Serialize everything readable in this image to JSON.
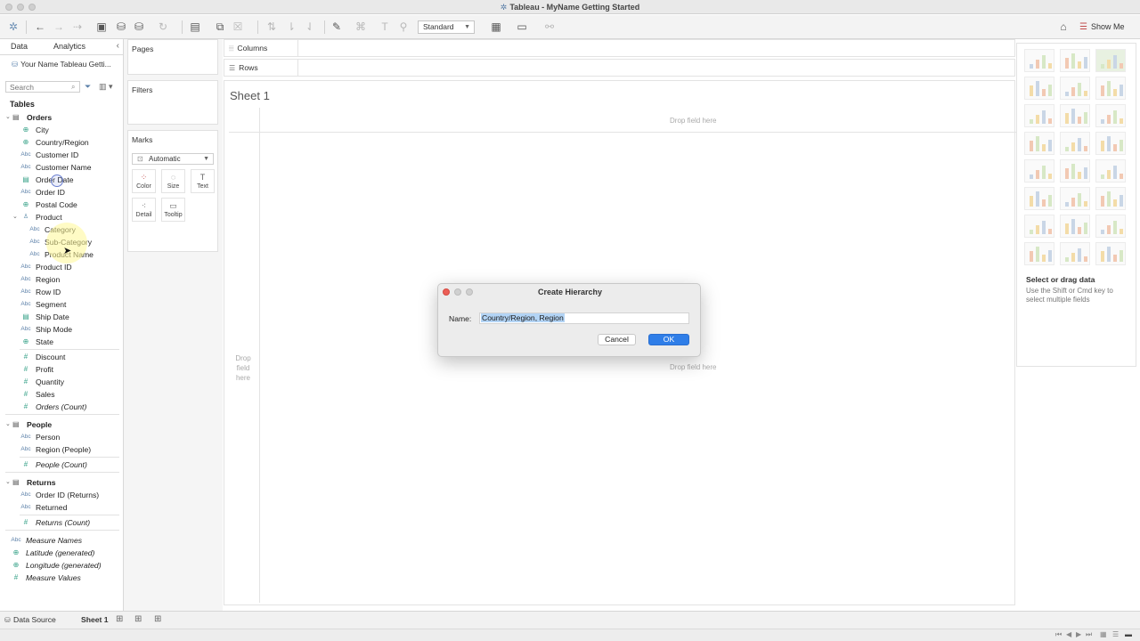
{
  "window": {
    "title": "Tableau - MyName Getting Started"
  },
  "toolbar": {
    "view_size": "Standard",
    "show_me_label": "Show Me"
  },
  "data_pane": {
    "tabs": [
      "Data",
      "Analytics"
    ],
    "datasource": "Your Name Tableau Getti...",
    "search_placeholder": "Search",
    "tables_label": "Tables",
    "tables": [
      {
        "name": "Orders",
        "fields": [
          {
            "label": "City",
            "type": "geo"
          },
          {
            "label": "Country/Region",
            "type": "geo"
          },
          {
            "label": "Customer ID",
            "type": "abc"
          },
          {
            "label": "Customer Name",
            "type": "abc"
          },
          {
            "label": "Order Date",
            "type": "date"
          },
          {
            "label": "Order ID",
            "type": "abc"
          },
          {
            "label": "Postal Code",
            "type": "geo"
          },
          {
            "label": "Product",
            "type": "hier"
          },
          {
            "label": "Category",
            "type": "abc",
            "child": true
          },
          {
            "label": "Sub-Category",
            "type": "abc",
            "child": true
          },
          {
            "label": "Product Name",
            "type": "abc",
            "child": true
          },
          {
            "label": "Product ID",
            "type": "abc"
          },
          {
            "label": "Region",
            "type": "abc"
          },
          {
            "label": "Row ID",
            "type": "abc"
          },
          {
            "label": "Segment",
            "type": "abc"
          },
          {
            "label": "Ship Date",
            "type": "date"
          },
          {
            "label": "Ship Mode",
            "type": "abc"
          },
          {
            "label": "State",
            "type": "geo"
          }
        ],
        "measures": [
          {
            "label": "Discount"
          },
          {
            "label": "Profit"
          },
          {
            "label": "Quantity"
          },
          {
            "label": "Sales"
          },
          {
            "label": "Orders (Count)",
            "italic": true
          }
        ]
      },
      {
        "name": "People",
        "fields": [
          {
            "label": "Person",
            "type": "abc"
          },
          {
            "label": "Region (People)",
            "type": "abc"
          }
        ],
        "measures": [
          {
            "label": "People (Count)",
            "italic": true
          }
        ]
      },
      {
        "name": "Returns",
        "fields": [
          {
            "label": "Order ID (Returns)",
            "type": "abc"
          },
          {
            "label": "Returned",
            "type": "abc"
          }
        ],
        "measures": [
          {
            "label": "Returns (Count)",
            "italic": true
          }
        ]
      }
    ],
    "generated": [
      {
        "label": "Measure Names",
        "type": "abc"
      },
      {
        "label": "Latitude (generated)",
        "type": "geo"
      },
      {
        "label": "Longitude (generated)",
        "type": "geo"
      },
      {
        "label": "Measure Values",
        "type": "num"
      }
    ]
  },
  "shelves": {
    "pages": "Pages",
    "filters": "Filters",
    "marks": "Marks",
    "mark_type": "Automatic",
    "mark_buttons": [
      "Color",
      "Size",
      "Text",
      "Detail",
      "Tooltip"
    ],
    "columns": "Columns",
    "rows": "Rows"
  },
  "sheet": {
    "title": "Sheet 1",
    "drop_field_here": "Drop field here",
    "drop_left": [
      "Drop",
      "field",
      "here"
    ]
  },
  "show_me": {
    "hint_title": "Select or drag data",
    "hint_text": "Use the Shift or Cmd key to select multiple fields"
  },
  "dialog": {
    "title": "Create Hierarchy",
    "name_label": "Name:",
    "name_value": "Country/Region, Region",
    "cancel_label": "Cancel",
    "ok_label": "OK"
  },
  "bottom": {
    "data_source_tab": "Data Source",
    "sheet_tab": "Sheet 1"
  },
  "colors": {
    "accent_blue": "#2f7ee8",
    "selection": "#b3d4f5",
    "field_green": "#3aa38a",
    "field_blue": "#5a7fa8"
  }
}
